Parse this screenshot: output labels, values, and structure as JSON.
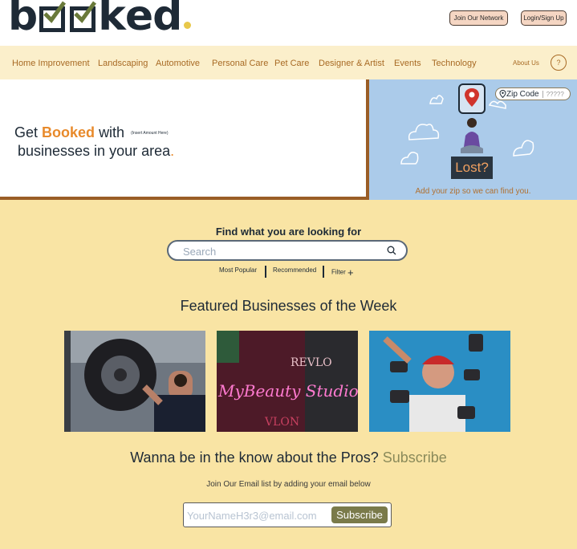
{
  "header": {
    "logo_letters": [
      "b",
      "k",
      "e",
      "d"
    ],
    "join_label": "Join Our Network",
    "login_label": "Login/Sign Up"
  },
  "nav": {
    "items": [
      "Home Improvement",
      "Landscaping",
      "Automotive",
      "Personal Care",
      "Pet Care",
      "Designer & Artist",
      "Events",
      "Technology"
    ],
    "about_label": "About Us",
    "help_label": "?"
  },
  "hero": {
    "line1_prefix": "Get",
    "line1_brand": "Booked",
    "line1_suffix": "with",
    "line1_small": "(Insert Amount Here)",
    "line2": "businesses in your area",
    "line2_dot": ".",
    "zip_label": "Zip Code",
    "zip_value": "?????",
    "lost_label": "Lost?",
    "caption": "Add your zip so we can find you."
  },
  "search": {
    "title": "Find what you are looking for",
    "placeholder": "Search",
    "tabs": [
      "Most Popular",
      "Recommended",
      "Filter"
    ],
    "filter_plus": "+"
  },
  "featured": {
    "title": "Featured Businesses of the Week",
    "card2_text1": "REVLO",
    "card2_text2": "MyBeauty Studio",
    "card2_text3": "VLON"
  },
  "subscribe": {
    "headline": "Wanna be in the know about the Pros?",
    "headline_link": "Subscribe",
    "join_text": "Join  Our Email list by adding your email below",
    "email_placeholder": "YourNameH3r3@email.com",
    "button_label": "Subscribe"
  },
  "colors": {
    "navy": "#1e2a36",
    "orange": "#e88a2b",
    "nav_text": "#a86a24",
    "main_bg": "#f9e4a4",
    "nav_bg": "#fbefcb",
    "hero_blue": "#abcbea",
    "subscribe_btn": "#7a7a4a"
  }
}
